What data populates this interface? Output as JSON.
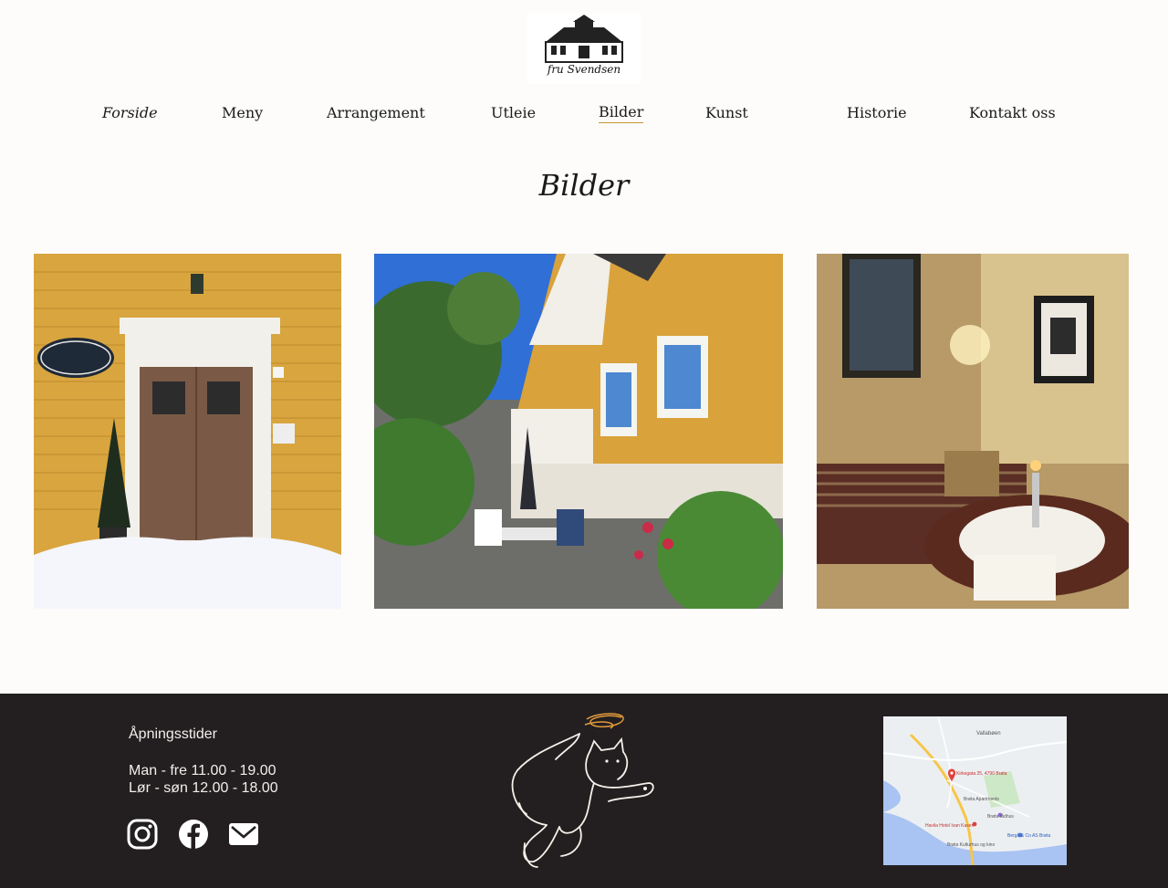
{
  "brand": {
    "logo_text": "fru Svendsen"
  },
  "nav": {
    "items": [
      {
        "label": "Forside"
      },
      {
        "label": "Meny"
      },
      {
        "label": "Arrangement"
      },
      {
        "label": "Utleie"
      },
      {
        "label": "Bilder"
      },
      {
        "label": "Kunst"
      },
      {
        "label": "Historie"
      },
      {
        "label": "Kontakt oss"
      }
    ],
    "active": "Bilder"
  },
  "main": {
    "title": "Bilder",
    "photos": [
      {
        "name": "cafe-door-photo"
      },
      {
        "name": "garden-terrace-photo"
      },
      {
        "name": "interior-lounge-photo"
      }
    ]
  },
  "footer": {
    "hours_title": "Åpningsstider",
    "hours": [
      "Man - fre 11.00 - 19.00",
      "Lør - søn 12.00 - 18.00"
    ],
    "social": [
      "instagram-icon",
      "facebook-icon",
      "mail-icon"
    ],
    "map": {
      "labels": [
        "Vallabøen",
        "Kirkegata 25, 4790 Brøta",
        "Brøta Apartments",
        "Havila Hotel Ivan Kasen",
        "Brøta rådhus",
        "Brøta Kulturhus og kino",
        "Bergå & Co AS Brøta"
      ]
    }
  },
  "colors": {
    "background": "#fdfcfa",
    "footer": "#231f20",
    "accent": "#c8962e"
  }
}
